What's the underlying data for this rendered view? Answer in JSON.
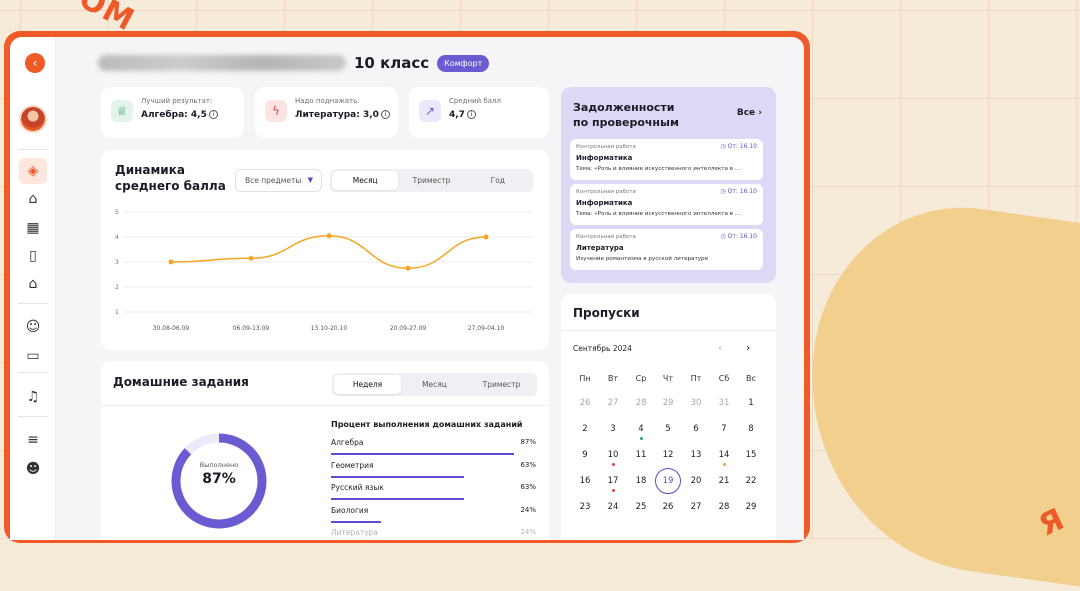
{
  "background_word": "ОМ",
  "background_word_right": "Я",
  "header": {
    "class_title": "10 класс",
    "badge": "Комфорт"
  },
  "stats": [
    {
      "label": "Лучший результат:",
      "value": "Алгебра: 4,5",
      "icon": "trophy-icon",
      "color": "#2aa36b"
    },
    {
      "label": "Надо поднажать:",
      "value": "Литература: 3,0",
      "icon": "bolt-icon",
      "color": "#e5484d"
    },
    {
      "label": "Средний балл",
      "value": "4,7",
      "icon": "trend-up-icon",
      "color": "#6b5bd2"
    }
  ],
  "dynamics": {
    "title_line1": "Динамика",
    "title_line2": "среднего балла",
    "select": "Все предметы",
    "tabs": [
      "Месяц",
      "Триместр",
      "Год"
    ],
    "active_tab": "Месяц"
  },
  "chart_data": {
    "type": "line",
    "categories": [
      "30.08-06.09",
      "06.09-13.09",
      "13.10-20.10",
      "20.09-27.09",
      "27.09-04.10"
    ],
    "values": [
      3.0,
      3.15,
      4.05,
      2.75,
      4.0
    ],
    "ylim": [
      1,
      5
    ],
    "yticks": [
      "5",
      "4",
      "3",
      "2",
      "1"
    ],
    "color": "#f5a623",
    "grid": true
  },
  "debts": {
    "title_line1": "Задолженности",
    "title_line2": "по проверочным",
    "all_label": "Все",
    "items": [
      {
        "type": "Контрольная работа",
        "date": "От: 16.10",
        "subject": "Информатика",
        "topic": "Тема: «Роль и влияние искусственного интеллекта в ..."
      },
      {
        "type": "Контрольная работа",
        "date": "От: 16.10",
        "subject": "Информатика",
        "topic": "Тема: «Роль и влияние искусственного интеллекта в ..."
      },
      {
        "type": "Контрольная работа",
        "date": "От: 16.10",
        "subject": "Литература",
        "topic": "Изучение романтизма в русской литературе"
      }
    ]
  },
  "homework": {
    "title": "Домашние задания",
    "tabs": [
      "Неделя",
      "Месяц",
      "Триместр"
    ],
    "active_tab": "Неделя",
    "donut_label": "Выполнено",
    "donut_value": "87%",
    "donut_fraction": 0.87,
    "percent_title": "Процент выполнения домашних заданий",
    "subjects": [
      {
        "name": "Алгебра",
        "value": "87%",
        "fraction": 0.87
      },
      {
        "name": "Геометрия",
        "value": "63%",
        "fraction": 0.63
      },
      {
        "name": "Русский язык",
        "value": "63%",
        "fraction": 0.63
      },
      {
        "name": "Биология",
        "value": "24%",
        "fraction": 0.24
      },
      {
        "name": "Литература",
        "value": "24%",
        "fraction": 0.24
      }
    ]
  },
  "absences": {
    "title": "Пропуски",
    "month": "Сентябрь 2024",
    "weekdays": [
      "Пн",
      "Вт",
      "Ср",
      "Чт",
      "Пт",
      "Сб",
      "Вс"
    ],
    "weeks": [
      [
        "26",
        "27",
        "28",
        "29",
        "30",
        "31",
        "1"
      ],
      [
        "2",
        "3",
        "4",
        "5",
        "6",
        "7",
        "8"
      ],
      [
        "9",
        "10",
        "11",
        "12",
        "13",
        "14",
        "15"
      ],
      [
        "16",
        "17",
        "18",
        "19",
        "20",
        "21",
        "22"
      ],
      [
        "23",
        "24",
        "25",
        "26",
        "27",
        "28",
        "29"
      ]
    ],
    "today": "19"
  }
}
